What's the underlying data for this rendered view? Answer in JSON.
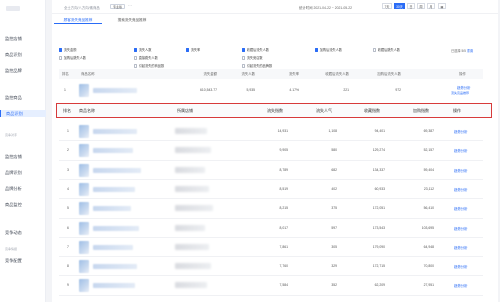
{
  "sidebar": {
    "sections": [
      "",
      "",
      "竞争对手",
      "",
      "竞争情报"
    ],
    "items": [
      {
        "label": "监控店铺"
      },
      {
        "label": "商品识别"
      },
      {
        "label": "监控品牌"
      },
      {
        "label": "监控商品"
      },
      {
        "label": "商品识别"
      },
      {
        "label": "监控店铺"
      },
      {
        "label": "品牌识别"
      },
      {
        "label": "品牌分析"
      },
      {
        "label": "商品监控"
      },
      {
        "label": "竞争动态"
      },
      {
        "label": "竞争配置"
      }
    ],
    "active_index": 4
  },
  "header": {
    "breadcrumb": "全土方向/八方向/素商品",
    "tag": "专业版",
    "date_range": "统计时间 2021-04-22 ~ 2021-05-22",
    "range_options": [
      "7天",
      "30天",
      "日",
      "周",
      "月"
    ],
    "active_range": "30天"
  },
  "tabs": [
    {
      "label": "顾客流失竞品推荐"
    },
    {
      "label": "搜索流失竞品推荐"
    }
  ],
  "checkboxes": [
    {
      "label": "流失金额",
      "checked": true
    },
    {
      "label": "流失人数",
      "checked": true
    },
    {
      "label": "流失率",
      "checked": true
    },
    {
      "label": "收藏后流失人数",
      "checked": true
    },
    {
      "label": "加购后流失人数",
      "checked": false
    },
    {
      "label": "收藏后跳失人数",
      "checked": false
    },
    {
      "label": "加购后跳失人数",
      "checked": false
    },
    {
      "label": "直接跳失人数",
      "checked": false
    },
    {
      "label": "流失竞店数",
      "checked": false
    },
    {
      "label": "引起流失的商品数",
      "checked": false
    },
    {
      "label": "引起流失的品牌数",
      "checked": false
    }
  ],
  "selected_text": "已选择",
  "selected_count": "5/5",
  "selected_reset": "重置",
  "summary": {
    "headers": [
      "排名",
      "商品名称",
      "流失金额",
      "流失人数",
      "流失率",
      "收藏后流失人数",
      "加购后流失人数",
      "操作"
    ],
    "row": {
      "rank": "1",
      "amount": "610,543.77",
      "count": "5,935",
      "rate": "4.17%",
      "fav": "221",
      "cart": "972",
      "op1": "趋势分析",
      "op2": "流失竞品推荐"
    }
  },
  "table": {
    "headers": [
      "排名",
      "商品名称",
      "所属店铺",
      "流失指数",
      "流失人气",
      "收藏指数",
      "加购指数",
      "操作"
    ],
    "op_label": "趋势分析",
    "rows": [
      {
        "rank": "1",
        "idx": "14,931",
        "pop": "1,108",
        "fav": "94,401",
        "cart": "69,387"
      },
      {
        "rank": "2",
        "idx": "9,905",
        "pop": "580",
        "fav": "129,274",
        "cart": "52,157"
      },
      {
        "rank": "3",
        "idx": "8,789",
        "pop": "682",
        "fav": "134,337",
        "cart": "59,404"
      },
      {
        "rank": "4",
        "idx": "8,519",
        "pop": "402",
        "fav": "60,933",
        "cart": "23,112"
      },
      {
        "rank": "5",
        "idx": "8,215",
        "pop": "375",
        "fav": "172,051",
        "cart": "56,410"
      },
      {
        "rank": "6",
        "idx": "8,017",
        "pop": "597",
        "fav": "173,543",
        "cart": "103,695"
      },
      {
        "rank": "7",
        "idx": "7,861",
        "pop": "305",
        "fav": "179,090",
        "cart": "64,948"
      },
      {
        "rank": "8",
        "idx": "7,760",
        "pop": "329",
        "fav": "172,715",
        "cart": "70,800"
      },
      {
        "rank": "9",
        "idx": "7,584",
        "pop": "352",
        "fav": "62,209",
        "cart": "27,951"
      }
    ]
  },
  "colors": {
    "accent": "#2a6cf6",
    "highlight": "#d73b3b"
  }
}
